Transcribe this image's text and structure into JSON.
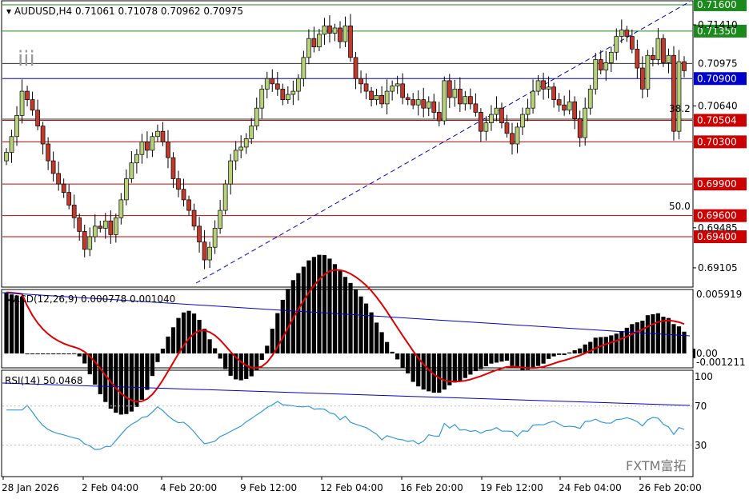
{
  "header": {
    "symbol": "AUDUSD,H4",
    "ohlc": "0.71061 0.71078 0.70962 0.70975",
    "wave_label": "iii"
  },
  "chart_data": {
    "type": "candlestick",
    "symbol": "AUDUSD",
    "timeframe": "H4",
    "price_axis": {
      "ylim": [
        0.6893,
        0.7163
      ],
      "ticks": [
        "0.71410",
        "0.70640",
        "0.69485",
        "0.69105"
      ],
      "current_price": "0.70975"
    },
    "time_labels": [
      "28 Jan 2026",
      "2 Feb 04:00",
      "4 Feb 20:00",
      "9 Feb 12:00",
      "12 Feb 04:00",
      "16 Feb 20:00",
      "19 Feb 12:00",
      "24 Feb 04:00",
      "26 Feb 20:00"
    ],
    "horizontal_levels": [
      {
        "price": 0.716,
        "label": "0.71600",
        "color": "#1a8a1a"
      },
      {
        "price": 0.7135,
        "label": "0.71350",
        "color": "#1a8a1a"
      },
      {
        "price": 0.709,
        "label": "0.70900",
        "color": "#0000cc"
      },
      {
        "price": 0.70504,
        "label": "0.70504",
        "color": "#cc0000"
      },
      {
        "price": 0.703,
        "label": "0.70300",
        "color": "#cc0000"
      },
      {
        "price": 0.699,
        "label": "0.69900",
        "color": "#cc0000"
      },
      {
        "price": 0.696,
        "label": "0.69600",
        "color": "#cc0000"
      },
      {
        "price": 0.694,
        "label": "0.69400",
        "color": "#cc0000"
      }
    ],
    "fib_labels": [
      "38.2",
      "50.0"
    ],
    "candles_close": [
      0.702,
      0.7035,
      0.7055,
      0.7078,
      0.707,
      0.706,
      0.7045,
      0.7028,
      0.7012,
      0.7,
      0.699,
      0.6982,
      0.697,
      0.6958,
      0.6945,
      0.6928,
      0.694,
      0.695,
      0.6948,
      0.6955,
      0.6942,
      0.6958,
      0.6975,
      0.6995,
      0.701,
      0.7018,
      0.703,
      0.7022,
      0.7035,
      0.704,
      0.703,
      0.7015,
      0.6995,
      0.6985,
      0.6975,
      0.6965,
      0.695,
      0.6935,
      0.6918,
      0.693,
      0.6948,
      0.6965,
      0.699,
      0.7012,
      0.7022,
      0.7025,
      0.7033,
      0.7045,
      0.7062,
      0.708,
      0.709,
      0.7085,
      0.708,
      0.707,
      0.7075,
      0.7078,
      0.709,
      0.711,
      0.7128,
      0.712,
      0.7132,
      0.714,
      0.7133,
      0.7138,
      0.7125,
      0.714,
      0.711,
      0.709,
      0.7085,
      0.7078,
      0.707,
      0.7074,
      0.7066,
      0.7078,
      0.7083,
      0.7085,
      0.7072,
      0.707,
      0.7065,
      0.707,
      0.7062,
      0.7068,
      0.7058,
      0.705,
      0.7088,
      0.7072,
      0.708,
      0.7066,
      0.7073,
      0.7066,
      0.7058,
      0.704,
      0.7048,
      0.7056,
      0.7062,
      0.7048,
      0.7038,
      0.7028,
      0.7044,
      0.7056,
      0.7062,
      0.7078,
      0.7088,
      0.708,
      0.7082,
      0.707,
      0.7065,
      0.706,
      0.7068,
      0.7052,
      0.7034,
      0.7062,
      0.708,
      0.7108,
      0.7098,
      0.7105,
      0.7115,
      0.713,
      0.7136,
      0.713,
      0.7118,
      0.71,
      0.708,
      0.7112,
      0.7108,
      0.7128,
      0.7105,
      0.7112,
      0.704,
      0.7106,
      0.70975
    ],
    "macd": {
      "label": "MACD(12,26,9) 0.000778 0.001040",
      "ticks": [
        "0.005919",
        "0.00",
        "-0.001211"
      ],
      "ylim": [
        -0.001211,
        0.005919
      ]
    },
    "rsi": {
      "label": "RSI(14) 50.0468",
      "ticks": [
        "100",
        "70",
        "30"
      ],
      "ylim": [
        0,
        100
      ]
    }
  },
  "watermark": "FXTM富拓"
}
